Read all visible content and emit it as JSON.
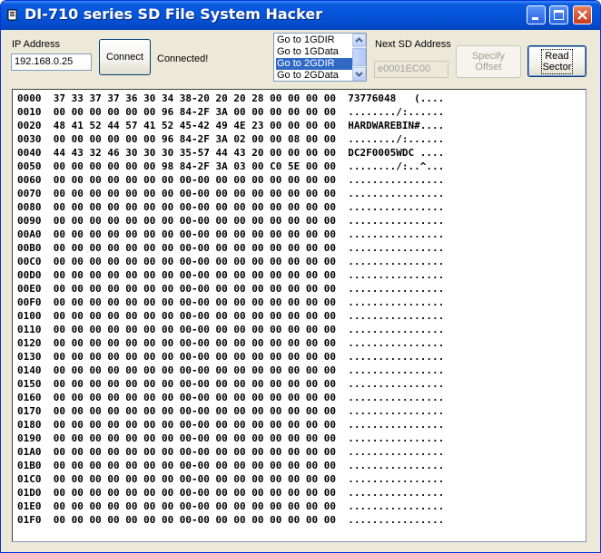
{
  "window": {
    "title": "DI-710 series SD File System Hacker",
    "icon": "app-document-icon",
    "controls": [
      "minimize-icon",
      "maximize-icon",
      "close-icon"
    ]
  },
  "toolbar": {
    "ip_label": "IP Address",
    "ip_value": "192.168.0.25",
    "connect_label": "Connect",
    "status_text": "Connected!",
    "goto_options": [
      "Go to 1GDIR",
      "Go to 1GData",
      "Go to 2GDIR",
      "Go to 2GData"
    ],
    "goto_selected_index": 2,
    "next_sd_label": "Next SD Address",
    "next_sd_value": "e0001EC00",
    "specify_offset_label": "Specify\nOffset",
    "read_sector_label": "Read\nSector"
  },
  "hex_rows": [
    "0000  37 33 37 37 36 30 34 38-20 20 20 28 00 00 00 00  73776048   (....",
    "0010  00 00 00 00 00 00 96 84-2F 3A 00 00 00 00 00 00  ......../:......",
    "0020  48 41 52 44 57 41 52 45-42 49 4E 23 00 00 00 00  HARDWAREBIN#....",
    "0030  00 00 00 00 00 00 96 84-2F 3A 02 00 00 08 00 00  ......../:......",
    "0040  44 43 32 46 30 30 30 35-57 44 43 20 00 00 00 00  DC2F0005WDC ....",
    "0050  00 00 00 00 00 00 98 84-2F 3A 03 00 C0 5E 00 00  ......../:..^...",
    "0060  00 00 00 00 00 00 00 00-00 00 00 00 00 00 00 00  ................",
    "0070  00 00 00 00 00 00 00 00-00 00 00 00 00 00 00 00  ................",
    "0080  00 00 00 00 00 00 00 00-00 00 00 00 00 00 00 00  ................",
    "0090  00 00 00 00 00 00 00 00-00 00 00 00 00 00 00 00  ................",
    "00A0  00 00 00 00 00 00 00 00-00 00 00 00 00 00 00 00  ................",
    "00B0  00 00 00 00 00 00 00 00-00 00 00 00 00 00 00 00  ................",
    "00C0  00 00 00 00 00 00 00 00-00 00 00 00 00 00 00 00  ................",
    "00D0  00 00 00 00 00 00 00 00-00 00 00 00 00 00 00 00  ................",
    "00E0  00 00 00 00 00 00 00 00-00 00 00 00 00 00 00 00  ................",
    "00F0  00 00 00 00 00 00 00 00-00 00 00 00 00 00 00 00  ................",
    "0100  00 00 00 00 00 00 00 00-00 00 00 00 00 00 00 00  ................",
    "0110  00 00 00 00 00 00 00 00-00 00 00 00 00 00 00 00  ................",
    "0120  00 00 00 00 00 00 00 00-00 00 00 00 00 00 00 00  ................",
    "0130  00 00 00 00 00 00 00 00-00 00 00 00 00 00 00 00  ................",
    "0140  00 00 00 00 00 00 00 00-00 00 00 00 00 00 00 00  ................",
    "0150  00 00 00 00 00 00 00 00-00 00 00 00 00 00 00 00  ................",
    "0160  00 00 00 00 00 00 00 00-00 00 00 00 00 00 00 00  ................",
    "0170  00 00 00 00 00 00 00 00-00 00 00 00 00 00 00 00  ................",
    "0180  00 00 00 00 00 00 00 00-00 00 00 00 00 00 00 00  ................",
    "0190  00 00 00 00 00 00 00 00-00 00 00 00 00 00 00 00  ................",
    "01A0  00 00 00 00 00 00 00 00-00 00 00 00 00 00 00 00  ................",
    "01B0  00 00 00 00 00 00 00 00-00 00 00 00 00 00 00 00  ................",
    "01C0  00 00 00 00 00 00 00 00-00 00 00 00 00 00 00 00  ................",
    "01D0  00 00 00 00 00 00 00 00-00 00 00 00 00 00 00 00  ................",
    "01E0  00 00 00 00 00 00 00 00-00 00 00 00 00 00 00 00  ................",
    "01F0  00 00 00 00 00 00 00 00-00 00 00 00 00 00 00 00  ................"
  ],
  "colors": {
    "titlebar": "#0654d8",
    "selection": "#316ac5",
    "window_face": "#ece9d8"
  }
}
